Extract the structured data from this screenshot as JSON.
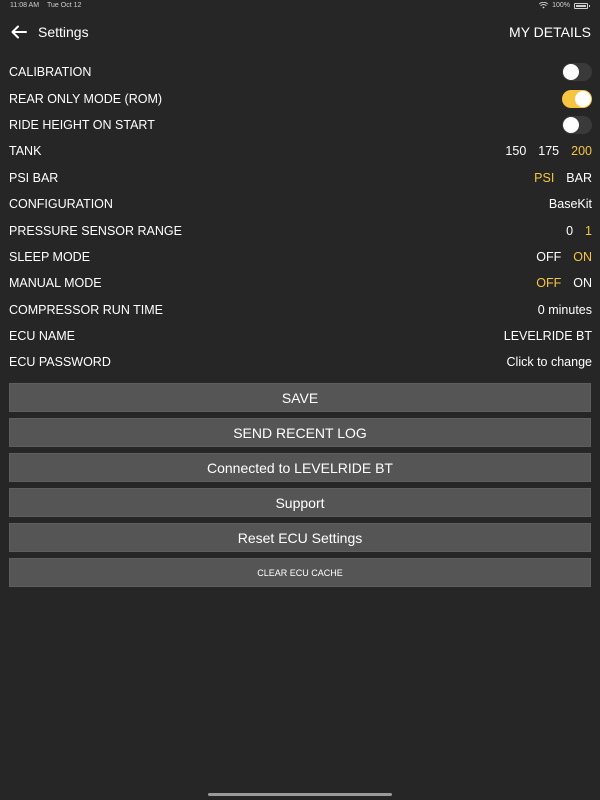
{
  "status": {
    "time": "11:08 AM",
    "date": "Tue Oct 12",
    "battery": "100%"
  },
  "header": {
    "title": "Settings",
    "action": "MY DETAILS"
  },
  "rows": {
    "calibration": {
      "label": "CALIBRATION",
      "on": false
    },
    "rom": {
      "label": "REAR ONLY MODE (ROM)",
      "on": true
    },
    "ride_height": {
      "label": "RIDE HEIGHT ON START",
      "on": false
    },
    "tank": {
      "label": "TANK",
      "options": [
        "150",
        "175",
        "200"
      ],
      "selected": "200"
    },
    "psi_bar": {
      "label": "PSI BAR",
      "options": [
        "PSI",
        "BAR"
      ],
      "selected": "PSI"
    },
    "configuration": {
      "label": "CONFIGURATION",
      "value": "BaseKit"
    },
    "pressure_range": {
      "label": "PRESSURE SENSOR RANGE",
      "options": [
        "0",
        "1"
      ],
      "selected": "1"
    },
    "sleep_mode": {
      "label": "SLEEP MODE",
      "options": [
        "OFF",
        "ON"
      ],
      "selected": "ON"
    },
    "manual_mode": {
      "label": "MANUAL MODE",
      "options": [
        "OFF",
        "ON"
      ],
      "selected": "OFF"
    },
    "compressor": {
      "label": "COMPRESSOR RUN TIME",
      "value": "0 minutes"
    },
    "ecu_name": {
      "label": "ECU NAME",
      "value": "LEVELRIDE BT"
    },
    "ecu_password": {
      "label": "ECU PASSWORD",
      "value": "Click to change"
    }
  },
  "buttons": {
    "save": "SAVE",
    "send_log": "SEND RECENT LOG",
    "connected": "Connected to LEVELRIDE BT",
    "support": "Support",
    "reset": "Reset ECU Settings",
    "clear_cache": "CLEAR ECU CACHE"
  },
  "colors": {
    "background": "#262626",
    "accent": "#f5c542",
    "button": "#555555"
  },
  "icons": {
    "back": "arrow-left-icon",
    "wifi": "wifi-icon",
    "battery": "battery-icon"
  }
}
